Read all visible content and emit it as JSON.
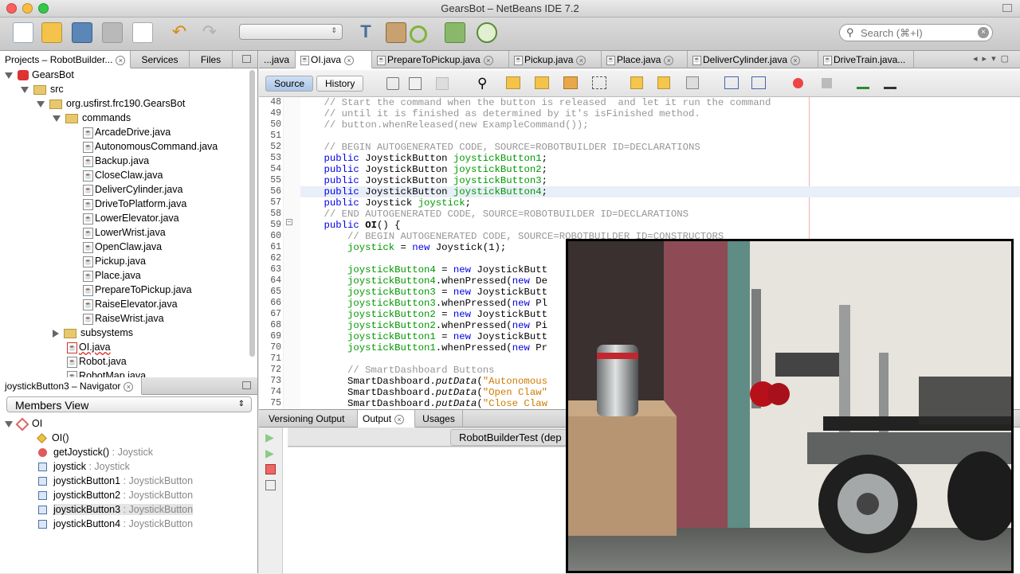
{
  "window": {
    "title": "GearsBot – NetBeans IDE 7.2"
  },
  "toolbar": {
    "search_placeholder": "Search (⌘+I)",
    "config_value": ""
  },
  "project_tabs": [
    {
      "label": "Projects – RobotBuilder...",
      "closable": true
    },
    {
      "label": "Services",
      "closable": false
    },
    {
      "label": "Files",
      "closable": false
    }
  ],
  "tree": {
    "root": "GearsBot",
    "src": "src",
    "package": "org.usfirst.frc190.GearsBot",
    "commands": "commands",
    "command_files": [
      "ArcadeDrive.java",
      "AutonomousCommand.java",
      "Backup.java",
      "CloseClaw.java",
      "DeliverCylinder.java",
      "DriveToPlatform.java",
      "LowerElevator.java",
      "LowerWrist.java",
      "OpenClaw.java",
      "Pickup.java",
      "Place.java",
      "PrepareToPickup.java",
      "RaiseElevator.java",
      "RaiseWrist.java"
    ],
    "subsystems": "subsystems",
    "other_files": [
      "OI.java",
      "Robot.java",
      "RobotMap.java"
    ]
  },
  "navigator": {
    "tab_label": "joystickButton3 – Navigator",
    "view_select": "Members View",
    "class_name": "OI",
    "members": [
      {
        "name": "OI()",
        "type": "",
        "kind": "constructor"
      },
      {
        "name": "getJoystick()",
        "type": " : Joystick",
        "kind": "method"
      },
      {
        "name": "joystick",
        "type": " : Joystick",
        "kind": "field"
      },
      {
        "name": "joystickButton1",
        "type": " : JoystickButton",
        "kind": "field"
      },
      {
        "name": "joystickButton2",
        "type": " : JoystickButton",
        "kind": "field"
      },
      {
        "name": "joystickButton3",
        "type": " : JoystickButton",
        "kind": "field",
        "selected": true
      },
      {
        "name": "joystickButton4",
        "type": " : JoystickButton",
        "kind": "field"
      }
    ]
  },
  "editor_tabs": [
    {
      "label": "...java",
      "closable": false
    },
    {
      "label": "OI.java",
      "closable": true,
      "active": true
    },
    {
      "label": "PrepareToPickup.java",
      "closable": true
    },
    {
      "label": "Pickup.java",
      "closable": true
    },
    {
      "label": "Place.java",
      "closable": true
    },
    {
      "label": "DeliverCylinder.java",
      "closable": true
    },
    {
      "label": "DriveTrain.java...",
      "closable": false
    }
  ],
  "editor_bar": {
    "source": "Source",
    "history": "History"
  },
  "line_numbers": [
    "48",
    "49",
    "50",
    "51",
    "52",
    "53",
    "54",
    "55",
    "56",
    "57",
    "58",
    "59",
    "60",
    "61",
    "62",
    "63",
    "64",
    "65",
    "66",
    "67",
    "68",
    "69",
    "70",
    "71",
    "72",
    "73",
    "74",
    "75"
  ],
  "code_lines": [
    "    // Start the command when the button is released  and let it run the command",
    "    // until it is finished as determined by it's isFinished method.",
    "    // button.whenReleased(new ExampleCommand());",
    "",
    "    // BEGIN AUTOGENERATED CODE, SOURCE=ROBOTBUILDER ID=DECLARATIONS",
    "    public JoystickButton joystickButton1;",
    "    public JoystickButton joystickButton2;",
    "    public JoystickButton joystickButton3;",
    "    public JoystickButton joystickButton4;",
    "    public Joystick joystick;",
    "    // END AUTOGENERATED CODE, SOURCE=ROBOTBUILDER ID=DECLARATIONS",
    "    public OI() {",
    "        // BEGIN AUTOGENERATED CODE, SOURCE=ROBOTBUILDER ID=CONSTRUCTORS",
    "        joystick = new Joystick(1);",
    "",
    "        joystickButton4 = new JoystickButt",
    "        joystickButton4.whenPressed(new De",
    "        joystickButton3 = new JoystickButt",
    "        joystickButton3.whenPressed(new Pl",
    "        joystickButton2 = new JoystickButt",
    "        joystickButton2.whenPressed(new Pi",
    "        joystickButton1 = new JoystickButt",
    "        joystickButton1.whenPressed(new Pr",
    "",
    "        // SmartDashboard Buttons",
    "        SmartDashboard.putData(\"Autonomous",
    "        SmartDashboard.putData(\"Open Claw\"",
    "        SmartDashboard.putData(\"Close Claw"
  ],
  "output": {
    "tabs": [
      {
        "label": "Versioning Output",
        "closable": false
      },
      {
        "label": "Output",
        "closable": true,
        "active": true
      },
      {
        "label": "Usages",
        "closable": false
      }
    ],
    "subtab": "RobotBuilderTest (dep"
  },
  "colors": {
    "keyword": "#0000e6",
    "field": "#009900",
    "comment": "#969696",
    "string": "#ce7b00",
    "selected_line": "#e9eff8"
  }
}
